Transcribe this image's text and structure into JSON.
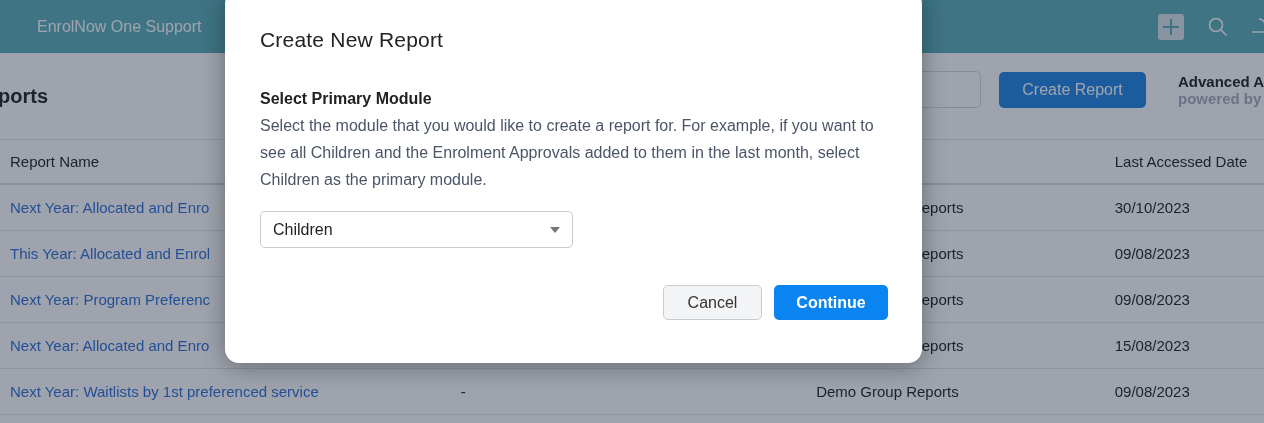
{
  "topbar": {
    "app_name": "EnrolNow One Support"
  },
  "page": {
    "title": "ports",
    "create_button": "Create Report",
    "promo_title": "Advanced A",
    "promo_subtitle": "powered by"
  },
  "table": {
    "columns": [
      "Report Name",
      "Last Accessed Date"
    ],
    "rows": [
      {
        "name": "Next Year: Allocated and Enro",
        "column_2": "",
        "folder": "eports",
        "last_accessed": "30/10/2023"
      },
      {
        "name": "This Year: Allocated and Enrol",
        "column_2": "",
        "folder": "eports",
        "last_accessed": "09/08/2023"
      },
      {
        "name": "Next Year: Program Preferenc",
        "column_2": "",
        "folder": "eports",
        "last_accessed": "09/08/2023"
      },
      {
        "name": "Next Year: Allocated and Enro",
        "column_2": "",
        "folder": "eports",
        "last_accessed": "15/08/2023"
      },
      {
        "name": "Next Year: Waitlists by 1st preferenced service",
        "column_2": "-",
        "folder": "Demo Group Reports",
        "last_accessed": "09/08/2023"
      }
    ]
  },
  "modal": {
    "title": "Create New Report",
    "section_label": "Select Primary Module",
    "description": "Select the module that you would like to create a report for. For example, if you want to see all Children and the Enrolment Approvals added to them in the last month, select Children as the primary module.",
    "select": {
      "value": "Children"
    },
    "buttons": [
      {
        "label": "Cancel",
        "kind": "secondary"
      },
      {
        "label": "Continue",
        "kind": "primary"
      }
    ]
  }
}
